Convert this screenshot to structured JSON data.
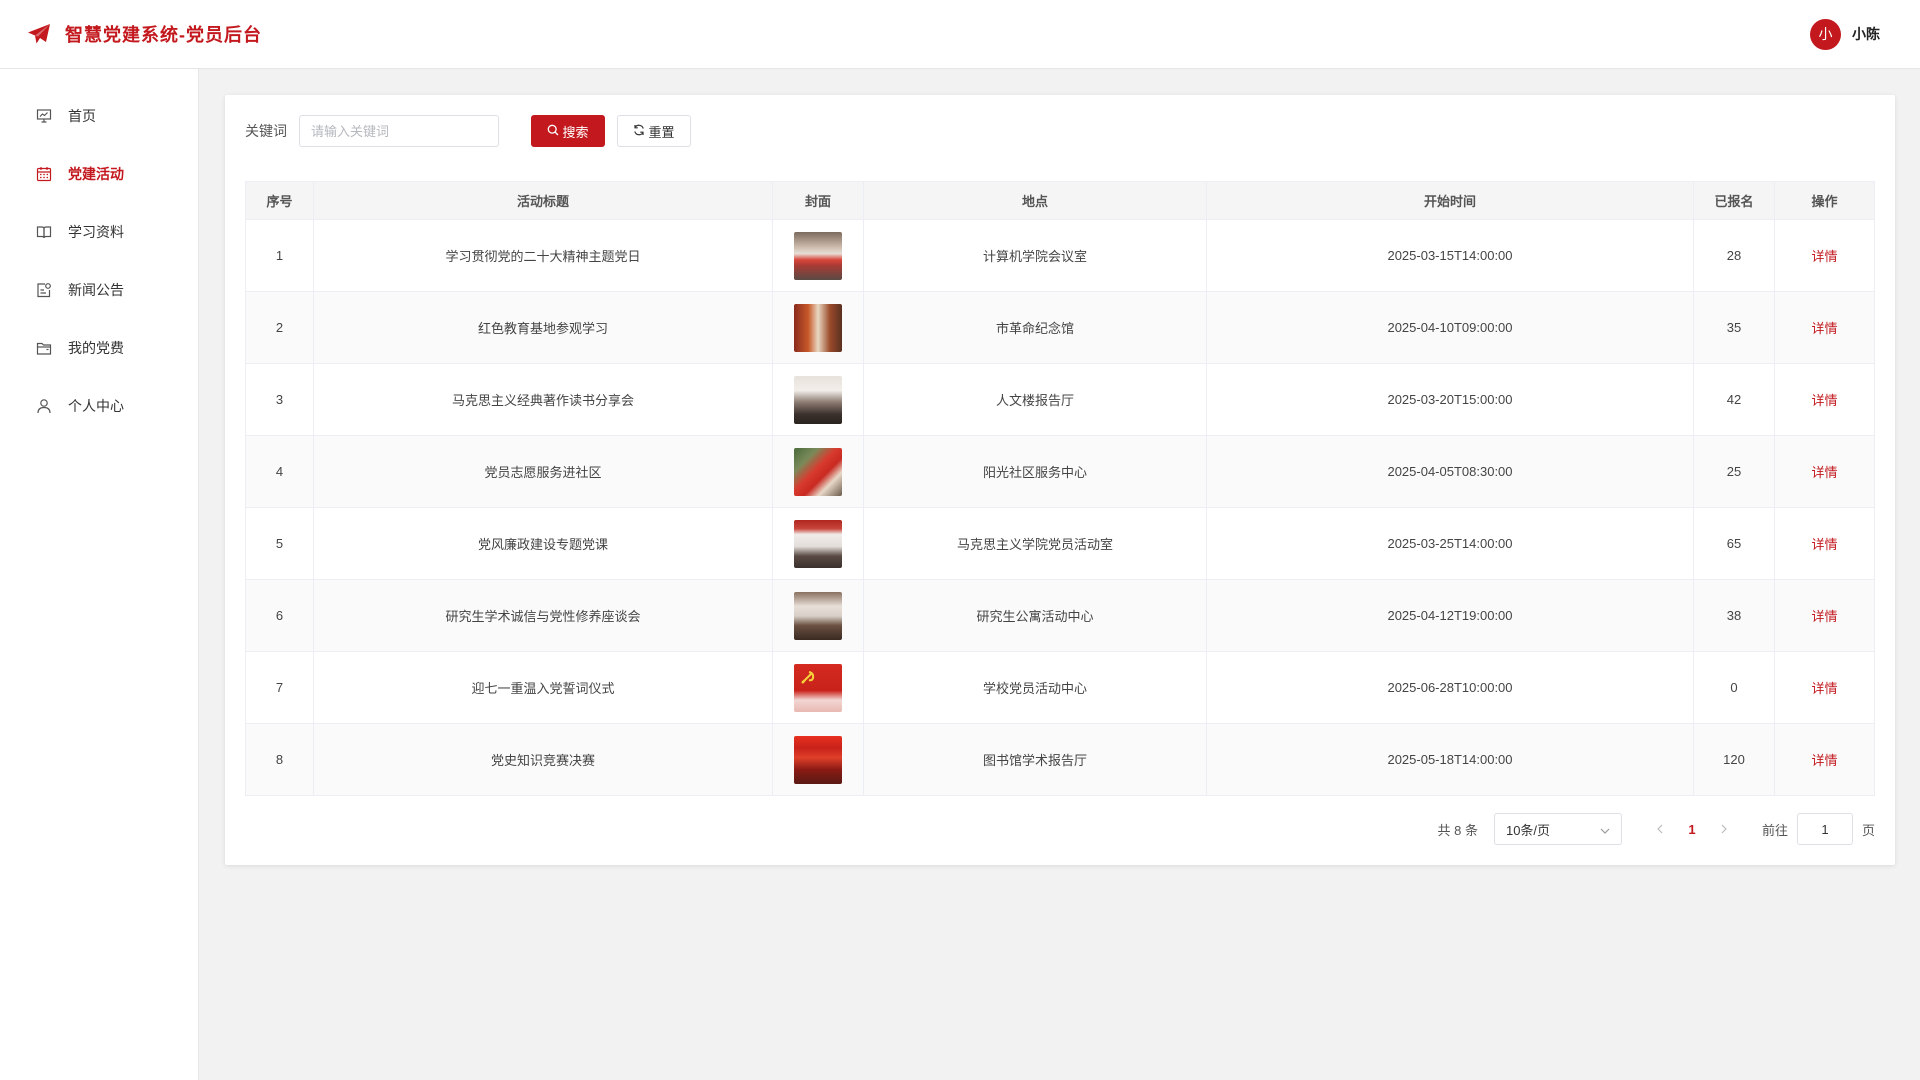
{
  "header": {
    "title": "智慧党建系统-党员后台",
    "avatar_text": "小",
    "username": "小陈"
  },
  "colors": {
    "brand_red": "#c3191e"
  },
  "sidebar": {
    "items": [
      {
        "label": "首页",
        "icon": "presentation-chart-icon",
        "active": false
      },
      {
        "label": "党建活动",
        "icon": "calendar-icon",
        "active": true
      },
      {
        "label": "学习资料",
        "icon": "book-icon",
        "active": false
      },
      {
        "label": "新闻公告",
        "icon": "notice-icon",
        "active": false
      },
      {
        "label": "我的党费",
        "icon": "wallet-icon",
        "active": false
      },
      {
        "label": "个人中心",
        "icon": "user-icon",
        "active": false
      }
    ]
  },
  "filter": {
    "keyword_label": "关键词",
    "keyword_placeholder": "请输入关键词",
    "keyword_value": "",
    "search_label": "搜索",
    "reset_label": "重置"
  },
  "table": {
    "columns": [
      "序号",
      "活动标题",
      "封面",
      "地点",
      "开始时间",
      "已报名",
      "操作"
    ],
    "rows": [
      {
        "index": "1",
        "title": "学习贯彻党的二十大精神主题党日",
        "location": "计算机学院会议室",
        "start": "2025-03-15T14:00:00",
        "enrolled": "28",
        "action": "详情"
      },
      {
        "index": "2",
        "title": "红色教育基地参观学习",
        "location": "市革命纪念馆",
        "start": "2025-04-10T09:00:00",
        "enrolled": "35",
        "action": "详情"
      },
      {
        "index": "3",
        "title": "马克思主义经典著作读书分享会",
        "location": "人文楼报告厅",
        "start": "2025-03-20T15:00:00",
        "enrolled": "42",
        "action": "详情"
      },
      {
        "index": "4",
        "title": "党员志愿服务进社区",
        "location": "阳光社区服务中心",
        "start": "2025-04-05T08:30:00",
        "enrolled": "25",
        "action": "详情"
      },
      {
        "index": "5",
        "title": "党风廉政建设专题党课",
        "location": "马克思主义学院党员活动室",
        "start": "2025-03-25T14:00:00",
        "enrolled": "65",
        "action": "详情"
      },
      {
        "index": "6",
        "title": "研究生学术诚信与党性修养座谈会",
        "location": "研究生公寓活动中心",
        "start": "2025-04-12T19:00:00",
        "enrolled": "38",
        "action": "详情"
      },
      {
        "index": "7",
        "title": "迎七一重温入党誓词仪式",
        "location": "学校党员活动中心",
        "start": "2025-06-28T10:00:00",
        "enrolled": "0",
        "action": "详情"
      },
      {
        "index": "8",
        "title": "党史知识竞赛决赛",
        "location": "图书馆学术报告厅",
        "start": "2025-05-18T14:00:00",
        "enrolled": "120",
        "action": "详情"
      }
    ]
  },
  "pagination": {
    "total_text": "共 8 条",
    "page_size": "10条/页",
    "current_page": "1",
    "goto_label": "前往",
    "goto_value": "1",
    "page_suffix": "页"
  }
}
